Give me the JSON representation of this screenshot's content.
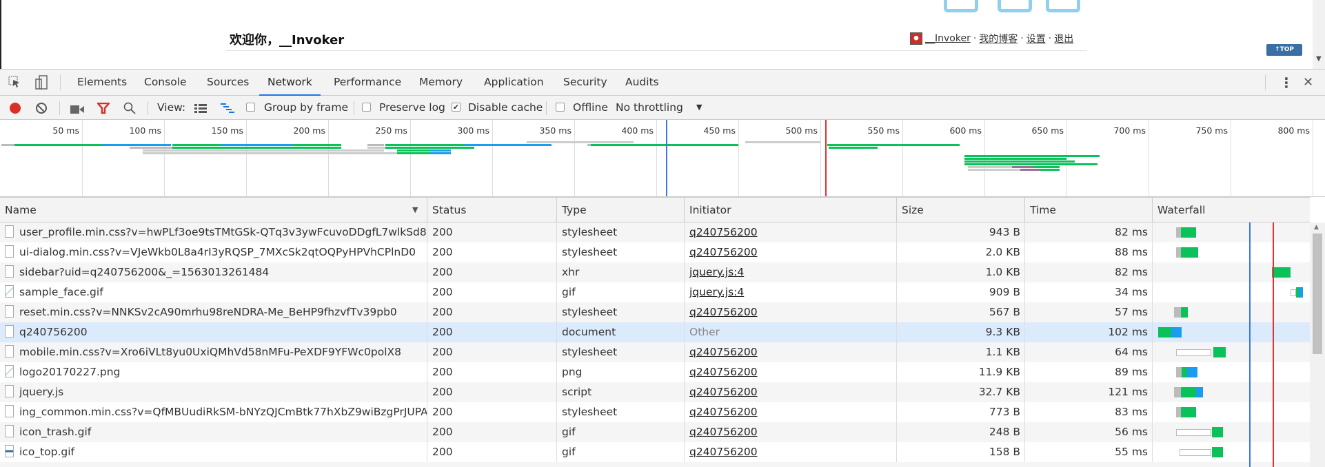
{
  "page": {
    "welcome": "欢迎你，__Invoker",
    "user": "__Invoker",
    "links": [
      " · ",
      "我的博客",
      " · ",
      "设置",
      " · ",
      "退出"
    ],
    "top_button": "↑TOP"
  },
  "devtools": {
    "tabs": [
      "Elements",
      "Console",
      "Sources",
      "Network",
      "Performance",
      "Memory",
      "Application",
      "Security",
      "Audits"
    ],
    "active_tab": "Network",
    "toolbar": {
      "view_label": "View:",
      "group_by_frame": "Group by frame",
      "group_by_frame_checked": false,
      "preserve_log": "Preserve log",
      "preserve_log_checked": false,
      "disable_cache": "Disable cache",
      "disable_cache_checked": true,
      "offline": "Offline",
      "offline_checked": false,
      "throttling": "No throttling"
    },
    "overview": {
      "ticks": [
        "50 ms",
        "100 ms",
        "150 ms",
        "200 ms",
        "250 ms",
        "300 ms",
        "350 ms",
        "400 ms",
        "450 ms",
        "500 ms",
        "550 ms",
        "600 ms",
        "650 ms",
        "700 ms",
        "750 ms",
        "800 ms"
      ],
      "dom_content_loaded_ms": 406,
      "load_ms": 503
    },
    "columns": [
      "Name",
      "Status",
      "Type",
      "Initiator",
      "Size",
      "Time",
      "Waterfall"
    ],
    "rows": [
      {
        "name": "user_profile.min.css?v=hwPLf3oe9tsTMtGSk-QTq3v3ywFcuvoDDgfL7wlkSd8",
        "status": "200",
        "type": "stylesheet",
        "initiator": "q240756200",
        "size": "943 B",
        "time": "82 ms",
        "icon": "stylesheet-file-icon"
      },
      {
        "name": "ui-dialog.min.css?v=VJeWkb0L8a4rI3yRQSP_7MXcSk2qtOQPyHPVhCPlnD0",
        "status": "200",
        "type": "stylesheet",
        "initiator": "q240756200",
        "size": "2.0 KB",
        "time": "88 ms",
        "icon": "stylesheet-file-icon"
      },
      {
        "name": "sidebar?uid=q240756200&_=1563013261484",
        "status": "200",
        "type": "xhr",
        "initiator": "jquery.js:4",
        "size": "1.0 KB",
        "time": "82 ms",
        "icon": "xhr-file-icon"
      },
      {
        "name": "sample_face.gif",
        "status": "200",
        "type": "gif",
        "initiator": "jquery.js:4",
        "size": "909 B",
        "time": "34 ms",
        "icon": "image-file-icon"
      },
      {
        "name": "reset.min.css?v=NNKSv2cA90mrhu98reNDRA-Me_BeHP9fhzvfTv39pb0",
        "status": "200",
        "type": "stylesheet",
        "initiator": "q240756200",
        "size": "567 B",
        "time": "57 ms",
        "icon": "stylesheet-file-icon"
      },
      {
        "name": "q240756200",
        "status": "200",
        "type": "document",
        "initiator": "Other",
        "size": "9.3 KB",
        "time": "102 ms",
        "icon": "document-file-icon",
        "selected": true
      },
      {
        "name": "mobile.min.css?v=Xro6iVLt8yu0UxiQMhVd58nMFu-PeXDF9YFWc0polX8",
        "status": "200",
        "type": "stylesheet",
        "initiator": "q240756200",
        "size": "1.1 KB",
        "time": "64 ms",
        "icon": "stylesheet-file-icon"
      },
      {
        "name": "logo20170227.png",
        "status": "200",
        "type": "png",
        "initiator": "q240756200",
        "size": "11.9 KB",
        "time": "89 ms",
        "icon": "image-file-icon"
      },
      {
        "name": "jquery.js",
        "status": "200",
        "type": "script",
        "initiator": "q240756200",
        "size": "32.7 KB",
        "time": "121 ms",
        "icon": "script-file-icon"
      },
      {
        "name": "ing_common.min.css?v=QfMBUudiRkSM-bNYzQJCmBtk77hXbZ9wiBzgPrJUPA4",
        "status": "200",
        "type": "stylesheet",
        "initiator": "q240756200",
        "size": "773 B",
        "time": "83 ms",
        "icon": "stylesheet-file-icon"
      },
      {
        "name": "icon_trash.gif",
        "status": "200",
        "type": "gif",
        "initiator": "q240756200",
        "size": "248 B",
        "time": "56 ms",
        "icon": "trash-image-icon"
      },
      {
        "name": "ico_top.gif",
        "status": "200",
        "type": "gif",
        "initiator": "q240756200",
        "size": "158 B",
        "time": "55 ms",
        "icon": "top-image-icon"
      }
    ],
    "waterfall_ms": [
      [
        [
          99,
          119,
          "#bbb"
        ],
        [
          119,
          183,
          "#0ac15a"
        ]
      ],
      [
        [
          99,
          119,
          "#bbb"
        ],
        [
          119,
          191,
          "#0ac15a"
        ]
      ],
      [
        [
          501,
          580,
          "#0ac15a"
        ]
      ],
      [
        [
          580,
          603,
          "#fff"
        ],
        [
          603,
          615,
          "#0ac15a"
        ],
        [
          615,
          632,
          "#1a9cf0"
        ]
      ],
      [
        [
          90,
          119,
          "#bbb"
        ],
        [
          119,
          148,
          "#0ac15a"
        ]
      ],
      [
        [
          23,
          78,
          "#0ac15a"
        ],
        [
          78,
          122,
          "#1a9cf0"
        ]
      ],
      [
        [
          99,
          246,
          "#fff"
        ],
        [
          255,
          307,
          "#0ac15a"
        ]
      ],
      [
        [
          99,
          122,
          "#bbb"
        ],
        [
          122,
          145,
          "#0ac15a"
        ],
        [
          145,
          188,
          "#1a9cf0"
        ]
      ],
      [
        [
          90,
          119,
          "#bbb"
        ],
        [
          119,
          183,
          "#0ac15a"
        ],
        [
          183,
          212,
          "#1a9cf0"
        ]
      ],
      [
        [
          99,
          119,
          "#bbb"
        ],
        [
          119,
          183,
          "#0ac15a"
        ]
      ],
      [
        [
          99,
          246,
          "#fff"
        ],
        [
          250,
          296,
          "#0ac15a"
        ]
      ],
      [
        [
          113,
          246,
          "#fff"
        ],
        [
          250,
          296,
          "#0ac15a"
        ]
      ]
    ],
    "overview_tracks_ms": [
      [
        [
          321,
          386,
          "#ccc"
        ],
        [
          454,
          500,
          "#ccc"
        ]
      ],
      [
        [
          1,
          9,
          "#bbb"
        ],
        [
          9,
          62,
          "#0ac15a"
        ],
        [
          62,
          104,
          "#1a9cf0"
        ],
        [
          105,
          135,
          "#0ac15a"
        ],
        [
          135,
          178,
          "#1a9cf0"
        ],
        [
          178,
          208,
          "#0ac15a"
        ],
        [
          224,
          234,
          "#bbb"
        ],
        [
          235,
          283,
          "#0ac15a"
        ],
        [
          283,
          336,
          "#1a9cf0"
        ],
        [
          358,
          360,
          "#bbb"
        ],
        [
          360,
          450,
          "#0ac15a"
        ],
        [
          504,
          585,
          "#0ac15a"
        ]
      ],
      [
        [
          79,
          105,
          "#bbb"
        ],
        [
          105,
          208,
          "#0ac15a"
        ],
        [
          224,
          235,
          "#ccc"
        ],
        [
          235,
          289,
          "#0ac15a"
        ],
        [
          505,
          535,
          "#0ac15a"
        ]
      ],
      [
        [
          87,
          234,
          "#ccc"
        ],
        [
          242,
          262,
          "#0ac15a"
        ],
        [
          262,
          275,
          "#1a9cf0"
        ]
      ],
      [
        [
          87,
          242,
          "#ccc"
        ],
        [
          242,
          262,
          "#0ac15a"
        ],
        [
          262,
          275,
          "#1a9cf0"
        ]
      ],
      [
        [
          588,
          670,
          "#0ac15a"
        ]
      ],
      [
        [
          588,
          650,
          "#0ac15a"
        ]
      ],
      [
        [
          588,
          655,
          "#0ac15a"
        ]
      ],
      [
        [
          588,
          669,
          "#0ac15a"
        ]
      ],
      [
        [
          590,
          617,
          "#ccc"
        ],
        [
          617,
          630,
          "#9c6f94"
        ],
        [
          630,
          646,
          "#0ac15a"
        ]
      ],
      [
        [
          590,
          622,
          "#ccc"
        ],
        [
          622,
          634,
          "#9c6f94"
        ],
        [
          634,
          646,
          "#0ac15a"
        ]
      ]
    ],
    "colors": {
      "accent": "#1a73e8",
      "record": "#d93025",
      "dcl_line": "#3b78e7",
      "load_line": "#d33"
    }
  }
}
